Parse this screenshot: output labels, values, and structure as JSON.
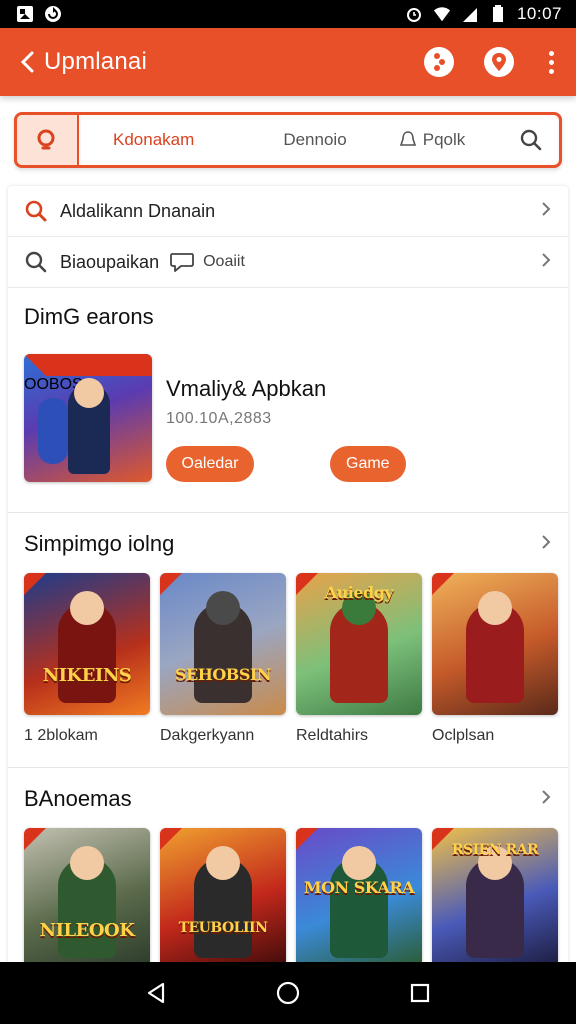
{
  "status_bar": {
    "time": "10:07"
  },
  "app_bar": {
    "title": "Upmlanai"
  },
  "search_tabs": {
    "tabs": [
      "Kdonakam",
      "Dennoio",
      "Pqolk"
    ]
  },
  "quick_rows": [
    {
      "label": "Aldalikann Dnanain"
    },
    {
      "label": "Biaoupaikan",
      "extra": "Ooaiit"
    }
  ],
  "featured_section": {
    "title": "DimG earons",
    "app": {
      "name": "Vmaliy& Apbkan",
      "meta": "100.10A,2883",
      "button_left": "Oaledar",
      "button_right": "Game",
      "thumb_tag": "OOBOS"
    }
  },
  "section_two": {
    "title": "Simpimgo iolng",
    "items": [
      {
        "label": "1 2blokam",
        "logo": "NIKEINS"
      },
      {
        "label": "Dakgerkyann",
        "logo": "SEHOBSIN"
      },
      {
        "label": "Reldtahirs",
        "logo": "Auiedgy"
      },
      {
        "label": "Oclplsan",
        "logo": ""
      }
    ]
  },
  "section_three": {
    "title": "BAnoemas",
    "items": [
      {
        "logo": "NILEOOK"
      },
      {
        "logo": "TEUBOLIIN"
      },
      {
        "logo": "MON SKARA"
      },
      {
        "logo": "RSIEN RAR"
      }
    ]
  },
  "colors": {
    "accent": "#e8502a",
    "button": "#e8632e",
    "active_tab": "#d9431f"
  }
}
